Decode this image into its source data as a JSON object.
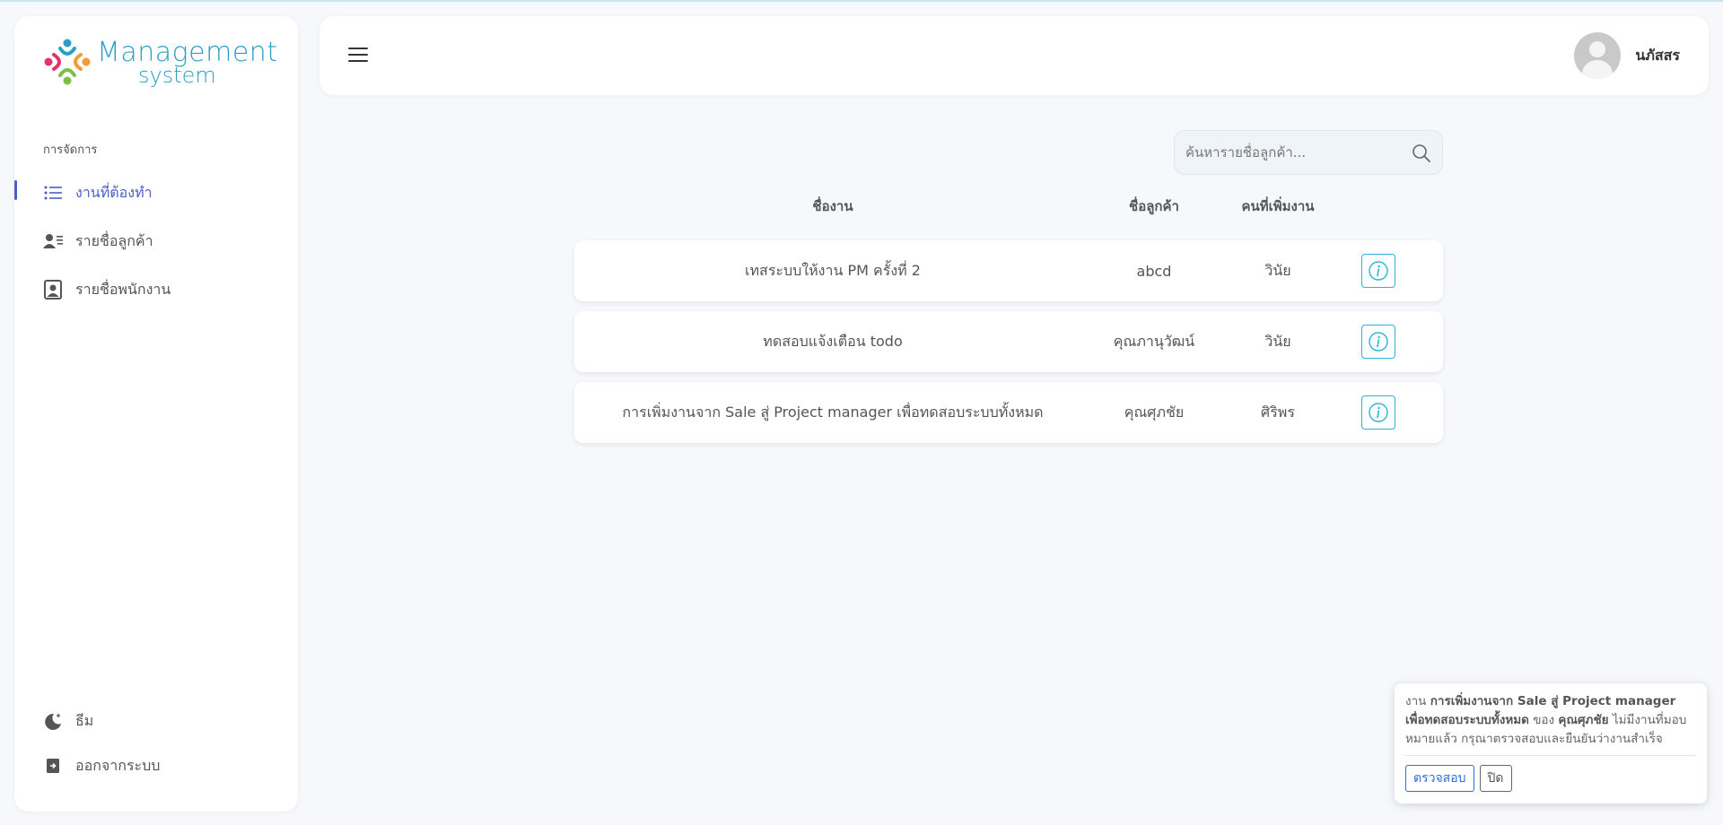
{
  "brand": {
    "line1": "Management",
    "line2": "system",
    "color": "#2c9fc8"
  },
  "sidebar": {
    "section_label": "การจัดการ",
    "items": [
      {
        "label": "งานที่ต้องทำ",
        "icon": "list-icon",
        "active": true
      },
      {
        "label": "รายชื่อลูกค้า",
        "icon": "user-list-icon",
        "active": false
      },
      {
        "label": "รายชื่อพนักงาน",
        "icon": "employee-badge-icon",
        "active": false
      }
    ],
    "bottom_items": [
      {
        "label": "ธีม",
        "icon": "moon-star-icon"
      },
      {
        "label": "ออกจากระบบ",
        "icon": "logout-icon"
      }
    ],
    "active_color": "#4a5ec8"
  },
  "header": {
    "menu_icon": "hamburger-icon",
    "user_name": "นภัสสร"
  },
  "search": {
    "placeholder": "ค้นหารายชื่อลูกค้า..."
  },
  "table": {
    "headers": {
      "task": "ชื่องาน",
      "customer": "ชื่อลูกค้า",
      "adder": "คนที่เพิ่มงาน"
    },
    "rows": [
      {
        "task": "เทสระบบให้งาน PM ครั้งที่ 2",
        "customer": "abcd",
        "adder": "วินัย"
      },
      {
        "task": "ทดสอบแจ้งเตือน todo",
        "customer": "คุณภานุวัฒน์",
        "adder": "วินัย"
      },
      {
        "task": "การเพิ่มงานจาก Sale สู่ Project manager เพื่อทดสอบระบบทั้งหมด",
        "customer": "คุณศุภชัย",
        "adder": "ศิริพร"
      }
    ],
    "action_icon": "info-icon",
    "action_color": "#26b7dc"
  },
  "toast": {
    "prefix": "งาน ",
    "task_name": "การเพิ่มงานจาก Sale สู่ Project manager เพื่อทดสอบระบบทั้งหมด",
    "middle": " ของ ",
    "customer": "คุณศุภชัย",
    "suffix": " ไม่มีงานที่มอบหมายแล้ว กรุณาตรวจสอบและยืนยันว่างานสำเร็จ",
    "check_label": "ตรวจสอบ",
    "close_label": "ปิด"
  }
}
